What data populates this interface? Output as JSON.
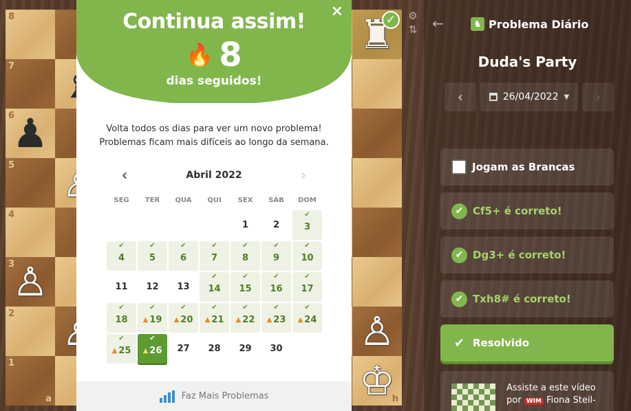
{
  "modal": {
    "title": "Continua assim!",
    "streak_count": "8",
    "streak_label": "dias seguidos!",
    "intro_line1": "Volta todos os dias para ver um novo problema!",
    "intro_line2": "Problemas ficam mais difíceis ao longo da semana.",
    "month_label": "Abril 2022",
    "close_glyph": "×",
    "weekdays": [
      "SEG",
      "TER",
      "QUA",
      "QUI",
      "SEX",
      "SÁB",
      "DOM"
    ],
    "weeks": [
      [
        null,
        null,
        null,
        null,
        {
          "d": "1",
          "s": ""
        },
        {
          "d": "2",
          "s": ""
        },
        {
          "d": "3",
          "s": "solved"
        }
      ],
      [
        {
          "d": "4",
          "s": "solved"
        },
        {
          "d": "5",
          "s": "solved"
        },
        {
          "d": "6",
          "s": "solved"
        },
        {
          "d": "7",
          "s": "solved"
        },
        {
          "d": "8",
          "s": "solved"
        },
        {
          "d": "9",
          "s": "solved"
        },
        {
          "d": "10",
          "s": "solved"
        }
      ],
      [
        {
          "d": "11",
          "s": ""
        },
        {
          "d": "12",
          "s": ""
        },
        {
          "d": "13",
          "s": ""
        },
        {
          "d": "14",
          "s": "solved"
        },
        {
          "d": "15",
          "s": "solved"
        },
        {
          "d": "16",
          "s": "solved"
        },
        {
          "d": "17",
          "s": "solved"
        }
      ],
      [
        {
          "d": "18",
          "s": "solved"
        },
        {
          "d": "19",
          "s": "streak"
        },
        {
          "d": "20",
          "s": "streak"
        },
        {
          "d": "21",
          "s": "streak"
        },
        {
          "d": "22",
          "s": "streak"
        },
        {
          "d": "23",
          "s": "streak"
        },
        {
          "d": "24",
          "s": "streak"
        }
      ],
      [
        {
          "d": "25",
          "s": "streak"
        },
        {
          "d": "26",
          "s": "current"
        },
        {
          "d": "27",
          "s": ""
        },
        {
          "d": "28",
          "s": ""
        },
        {
          "d": "29",
          "s": ""
        },
        {
          "d": "30",
          "s": ""
        },
        null
      ]
    ],
    "footer_label": "Faz Mais Problemas"
  },
  "board": {
    "ranks": [
      "8",
      "7",
      "6",
      "5",
      "4",
      "3",
      "2",
      "1"
    ],
    "file_a": "a",
    "file_h": "h",
    "pieces": [
      {
        "row": 0,
        "col": 7,
        "glyph": "♜",
        "color": "white",
        "name": "white-rook",
        "badge": true
      },
      {
        "row": 1,
        "col": 1,
        "glyph": "♝",
        "color": "black",
        "name": "black-bishop"
      },
      {
        "row": 2,
        "col": 0,
        "glyph": "♟",
        "color": "black",
        "name": "black-pawn"
      },
      {
        "row": 3,
        "col": 1,
        "glyph": "♙",
        "color": "white",
        "name": "white-pawn"
      },
      {
        "row": 5,
        "col": 0,
        "glyph": "♙",
        "color": "white",
        "name": "white-pawn"
      },
      {
        "row": 6,
        "col": 1,
        "glyph": "♙",
        "color": "white",
        "name": "white-pawn"
      },
      {
        "row": 6,
        "col": 7,
        "glyph": "♙",
        "color": "white",
        "name": "white-pawn"
      },
      {
        "row": 7,
        "col": 7,
        "glyph": "♔",
        "color": "white",
        "name": "white-king"
      }
    ]
  },
  "panel": {
    "title": "Problema Diário",
    "puzzle_name": "Duda's Party",
    "date": "26/04/2022",
    "cards": [
      {
        "text": "Jogam as Brancas",
        "kind": "side"
      },
      {
        "text": "Cf5+ é correto!",
        "kind": "ok"
      },
      {
        "text": "Dg3+ é correto!",
        "kind": "ok"
      },
      {
        "text": "Txh8# é correto!",
        "kind": "ok"
      }
    ],
    "solved_label": "Resolvido",
    "video_text_pre": "Assiste a este vídeo por",
    "video_badge": "WIM",
    "video_author": "Fiona Steil-"
  },
  "colors": {
    "accent": "#81b64c",
    "flame": "#ff8a2a"
  }
}
